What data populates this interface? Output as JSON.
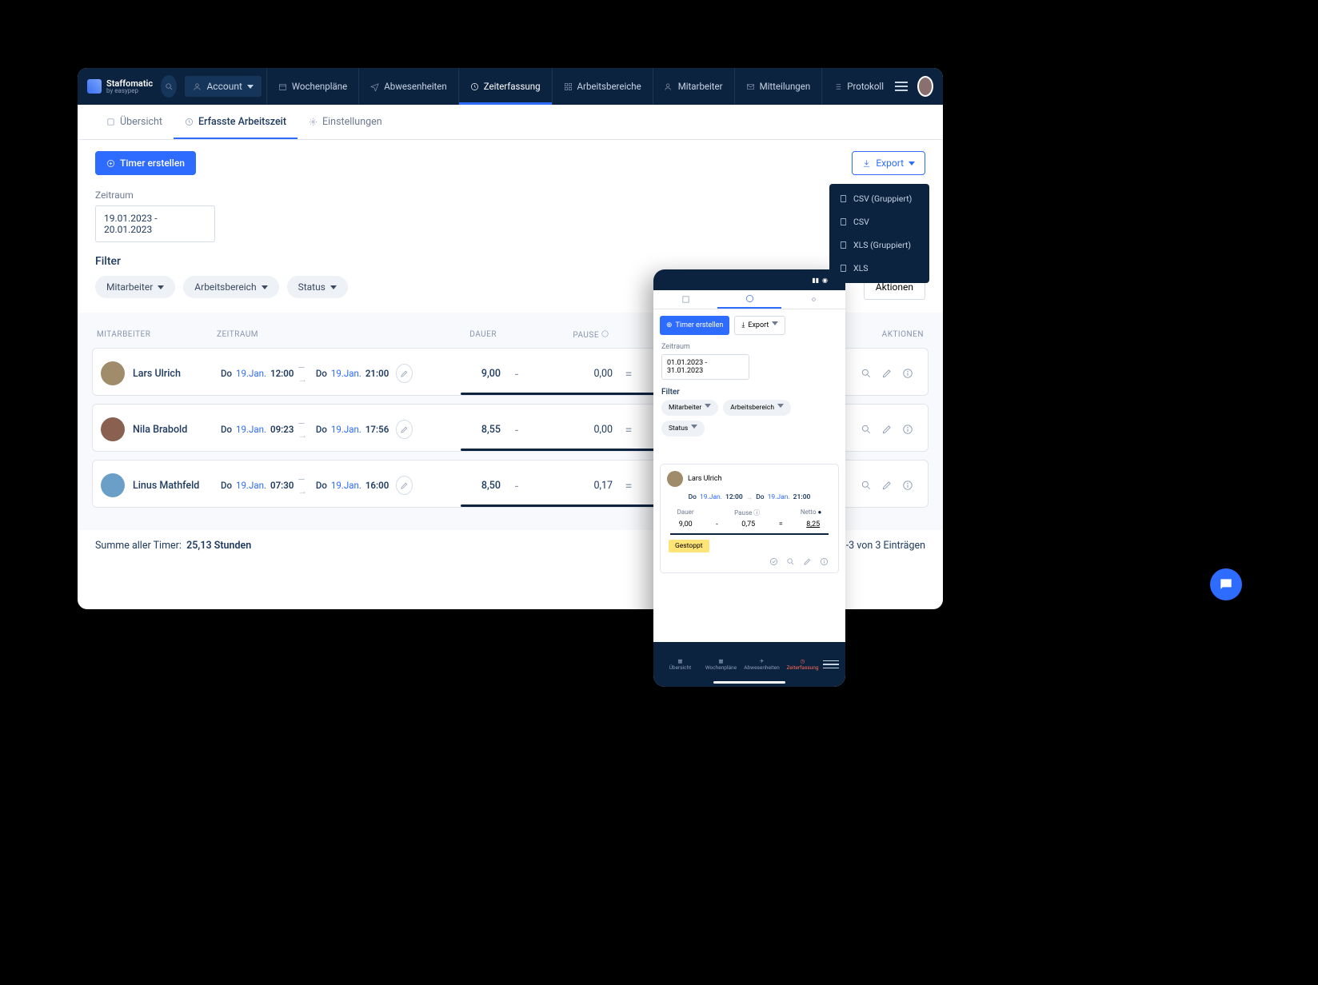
{
  "brand": {
    "name": "Staffomatic",
    "sub": "by easypep"
  },
  "topnav": {
    "account": "Account",
    "items": [
      "Wochenpläne",
      "Abwesenheiten",
      "Zeiterfassung",
      "Arbeitsbereiche",
      "Mitarbeiter",
      "Mitteilungen",
      "Protokoll"
    ],
    "active": 2
  },
  "tabs": {
    "items": [
      "Übersicht",
      "Erfasste Arbeitszeit",
      "Einstellungen"
    ],
    "active": 1
  },
  "toolbar": {
    "create": "Timer erstellen",
    "export": "Export"
  },
  "export_menu": [
    "CSV (Gruppiert)",
    "CSV",
    "XLS (Gruppiert)",
    "XLS"
  ],
  "period": {
    "label": "Zeitraum",
    "value": "19.01.2023 - 20.01.2023"
  },
  "filter": {
    "label": "Filter",
    "pills": [
      "Mitarbeiter",
      "Arbeitsbereich",
      "Status"
    ],
    "actions": "Aktionen"
  },
  "table": {
    "headers": {
      "emp": "MITARBEITER",
      "period": "ZEITRAUM",
      "dur": "DAUER",
      "pause": "PAUSE",
      "actions": "AKTIONEN"
    },
    "rows": [
      {
        "name": "Lars Ulrich",
        "day1": "Do",
        "date1": "19.Jan.",
        "t1": "12:00",
        "day2": "Do",
        "date2": "19.Jan.",
        "t2": "21:00",
        "dur": "9,00",
        "pause": "0,00"
      },
      {
        "name": "Nila Brabold",
        "day1": "Do",
        "date1": "19.Jan.",
        "t1": "09:23",
        "day2": "Do",
        "date2": "19.Jan.",
        "t2": "17:56",
        "dur": "8,55",
        "pause": "0,00"
      },
      {
        "name": "Linus Mathfeld",
        "day1": "Do",
        "date1": "19.Jan.",
        "t1": "07:30",
        "day2": "Do",
        "date2": "19.Jan.",
        "t2": "16:00",
        "dur": "8,50",
        "pause": "0,17"
      }
    ]
  },
  "summary": {
    "label": "Summe aller Timer:",
    "value": "25,13 Stunden",
    "count": "1-3 von 3 Einträgen"
  },
  "mobile": {
    "toolbar": {
      "create": "Timer erstellen",
      "export": "Export"
    },
    "period": {
      "label": "Zeitraum",
      "value": "01.01.2023 - 31.01.2023"
    },
    "filter": {
      "label": "Filter",
      "pills": [
        "Mitarbeiter",
        "Arbeitsbereich",
        "Status"
      ]
    },
    "card": {
      "name": "Lars Ulrich",
      "day1": "Do",
      "date1": "19.Jan.",
      "t1": "12:00",
      "day2": "Do",
      "date2": "19.Jan.",
      "t2": "21:00",
      "stats": {
        "dauer": "Dauer",
        "pause": "Pause",
        "netto": "Netto"
      },
      "vals": {
        "dauer": "9,00",
        "pause": "0,75",
        "netto": "8,25"
      },
      "op1": "-",
      "op2": "=",
      "badge": "Gestoppt"
    },
    "bottom": [
      "Übersicht",
      "Wochenpläne",
      "Abwesenheiten",
      "Zeiterfassung"
    ]
  }
}
